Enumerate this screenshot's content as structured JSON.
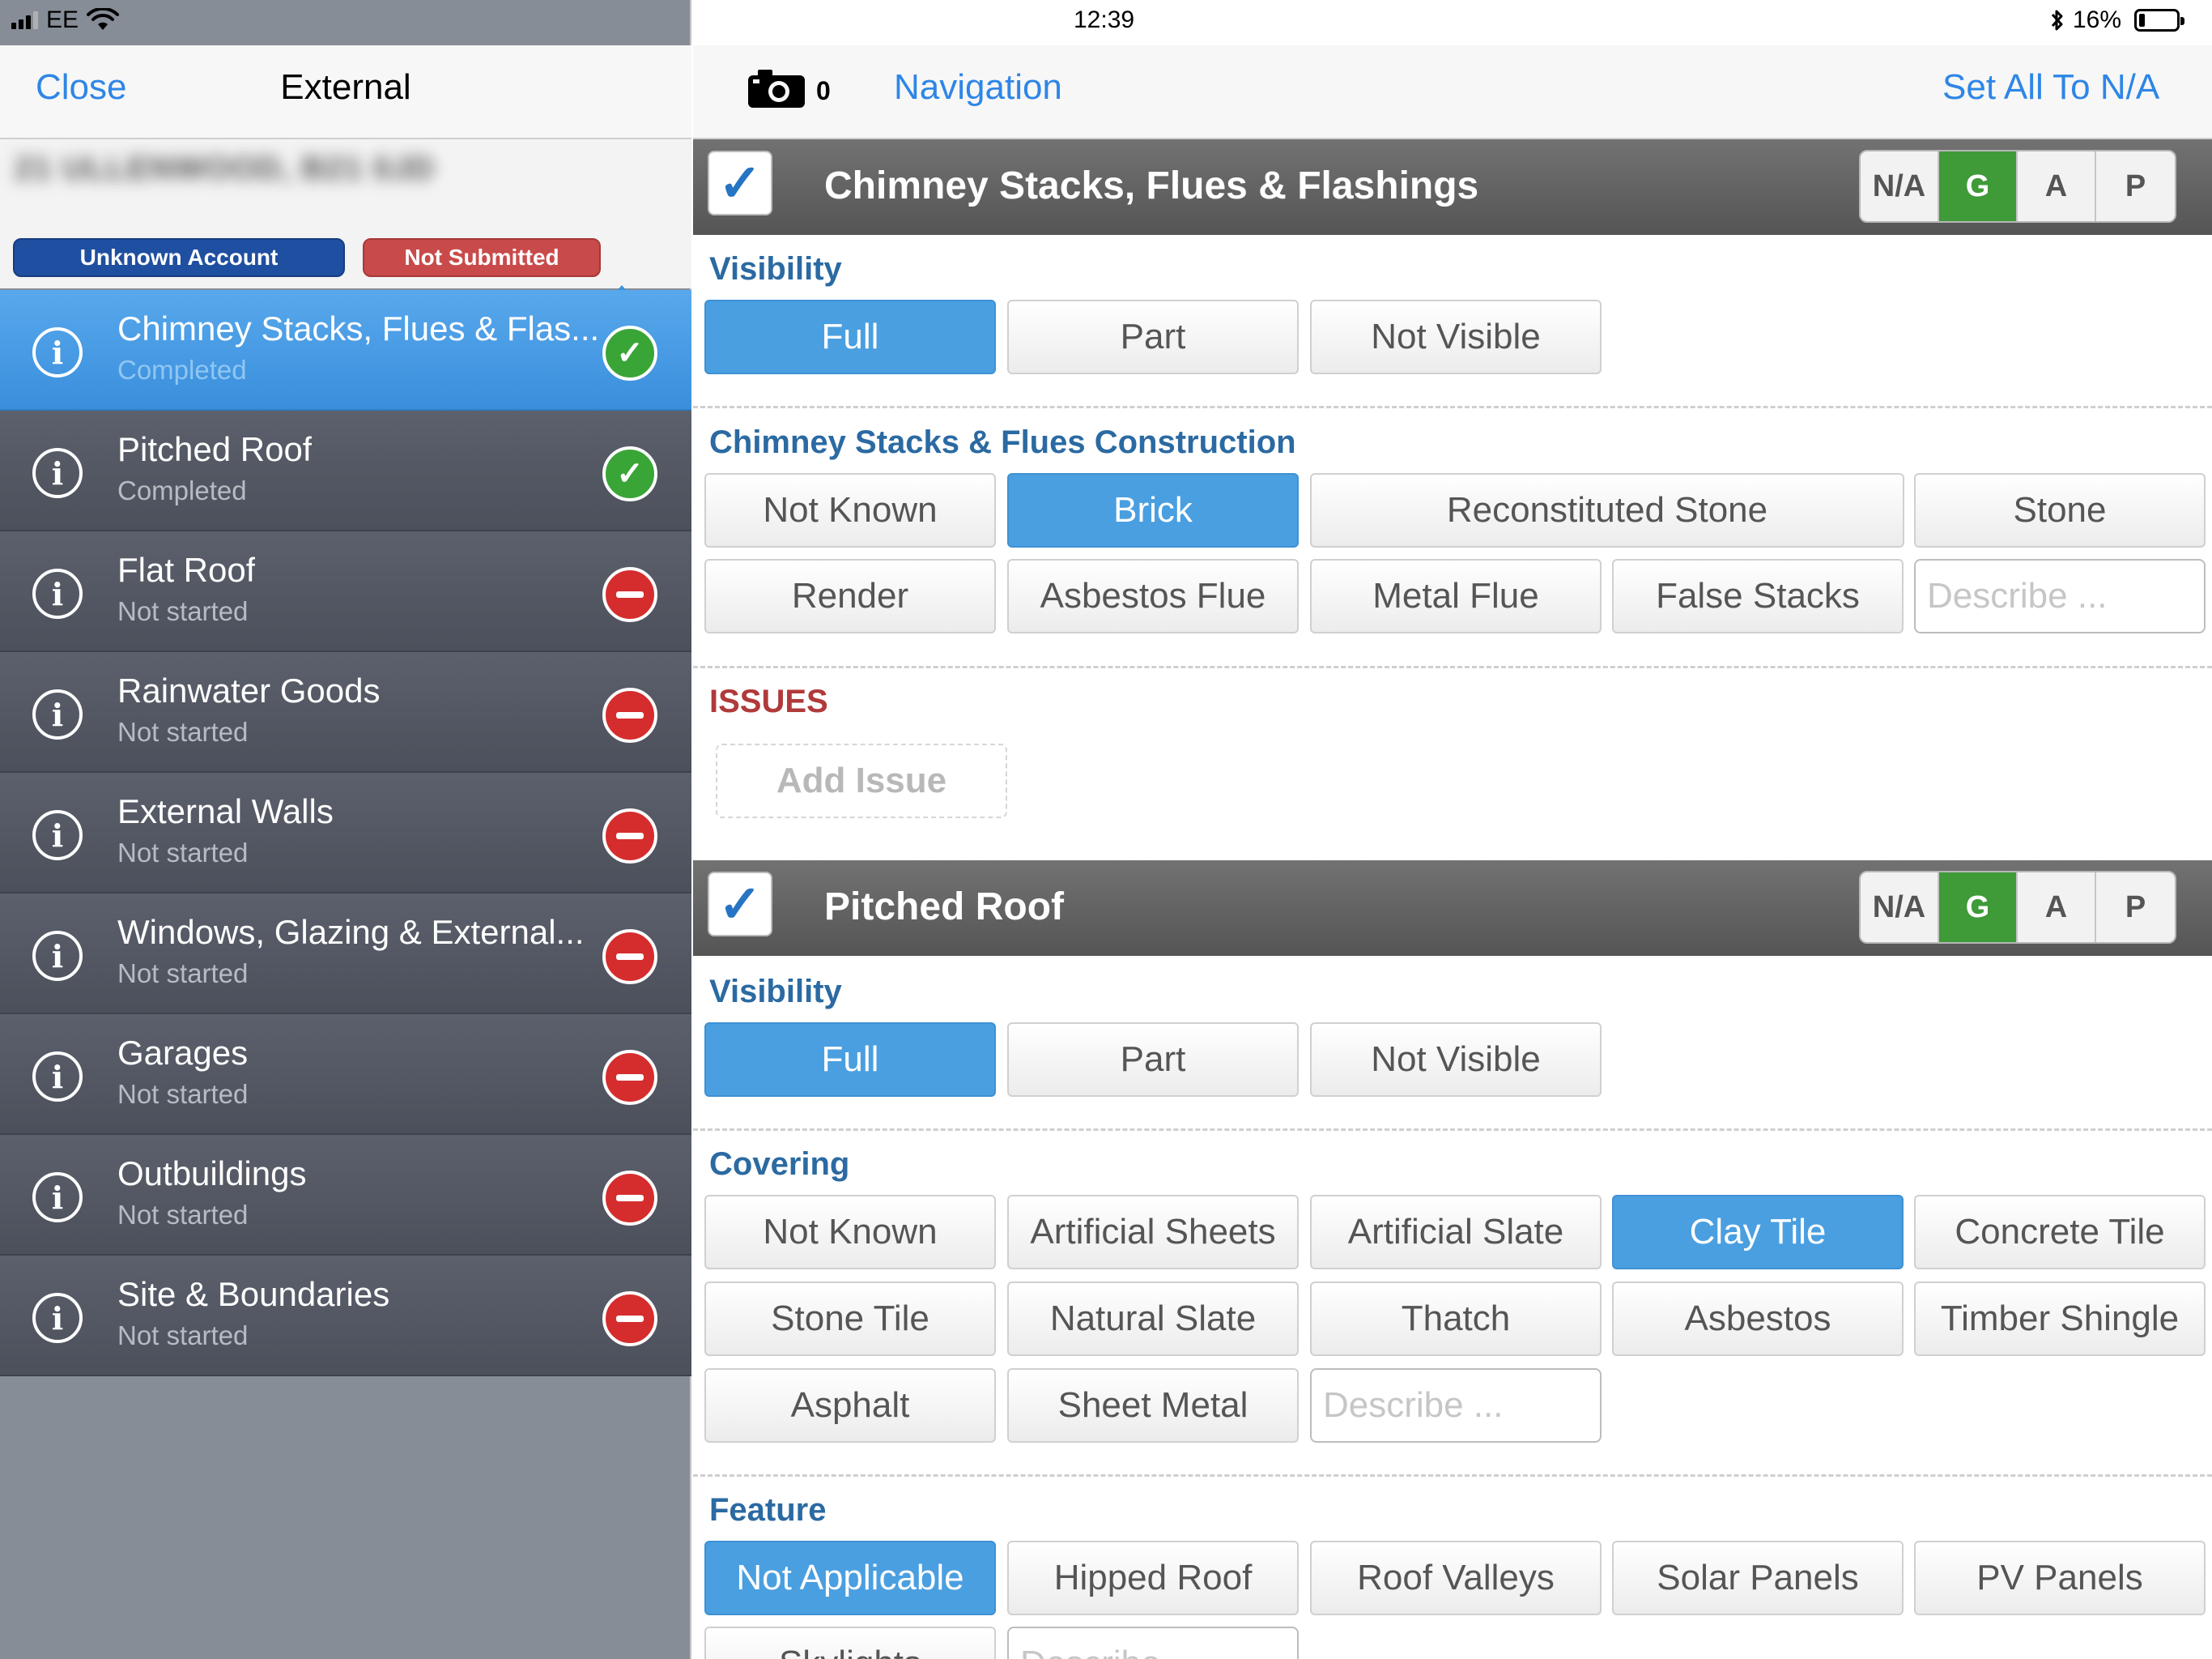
{
  "status_bar": {
    "carrier": "EE",
    "time": "12:39",
    "battery_percent": "16%",
    "battery_level": 0.16
  },
  "sidebar": {
    "close_label": "Close",
    "title": "External",
    "address": "21 ULLENWOOD, B21 0JD",
    "account_badge": "Unknown Account",
    "submission_badge": "Not Submitted",
    "items": [
      {
        "title": "Chimney Stacks, Flues & Flas...",
        "status": "Completed",
        "state": "ok"
      },
      {
        "title": "Pitched Roof",
        "status": "Completed",
        "state": "ok"
      },
      {
        "title": "Flat Roof",
        "status": "Not started",
        "state": "no"
      },
      {
        "title": "Rainwater Goods",
        "status": "Not started",
        "state": "no"
      },
      {
        "title": "External Walls",
        "status": "Not started",
        "state": "no"
      },
      {
        "title": "Windows, Glazing & External...",
        "status": "Not started",
        "state": "no"
      },
      {
        "title": "Garages",
        "status": "Not started",
        "state": "no"
      },
      {
        "title": "Outbuildings",
        "status": "Not started",
        "state": "no"
      },
      {
        "title": "Site & Boundaries",
        "status": "Not started",
        "state": "no"
      }
    ]
  },
  "toolbar": {
    "photo_count": "0",
    "navigation_label": "Navigation",
    "set_all_label": "Set All To N/A"
  },
  "rating_labels": {
    "na": "N/A",
    "g": "G",
    "a": "A",
    "p": "P"
  },
  "chimney": {
    "title": "Chimney Stacks, Flues & Flashings",
    "check": "✓",
    "selected_rating": "G",
    "visibility_label": "Visibility",
    "visibility": [
      "Full",
      "Part",
      "Not Visible"
    ],
    "construction_label": "Chimney Stacks & Flues Construction",
    "construction": [
      "Not Known",
      "Brick",
      "Reconstituted Stone",
      "Stone",
      "Render",
      "Asbestos Flue",
      "Metal Flue",
      "False Stacks"
    ],
    "describe_placeholder": "Describe ...",
    "issues_label": "ISSUES",
    "add_issue_label": "Add Issue"
  },
  "pitched_roof": {
    "title": "Pitched Roof",
    "check": "✓",
    "selected_rating": "G",
    "visibility_label": "Visibility",
    "visibility": [
      "Full",
      "Part",
      "Not Visible"
    ],
    "covering_label": "Covering",
    "covering": [
      "Not Known",
      "Artificial Sheets",
      "Artificial Slate",
      "Clay Tile",
      "Concrete Tile",
      "Stone Tile",
      "Natural Slate",
      "Thatch",
      "Asbestos",
      "Timber Shingle",
      "Asphalt",
      "Sheet Metal"
    ],
    "describe_placeholder": "Describe ...",
    "feature_label": "Feature",
    "feature": [
      "Not Applicable",
      "Hipped Roof",
      "Roof Valleys",
      "Solar Panels",
      "PV Panels",
      "Skylights"
    ],
    "feature_describe_placeholder": "Describe ..."
  }
}
